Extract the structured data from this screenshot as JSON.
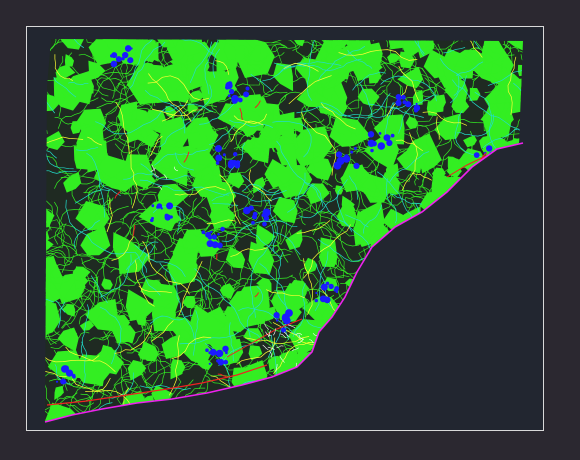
{
  "window": {
    "background": "#2b2830",
    "model_space_background": "#222630",
    "frame_color": "#d9d9d9"
  },
  "map": {
    "layers": [
      {
        "name": "land-green",
        "color": "#33ee22"
      },
      {
        "name": "roads-yellow",
        "color": "#ffff33"
      },
      {
        "name": "hydro-cyan",
        "color": "#22ddcc"
      },
      {
        "name": "water-blue",
        "color": "#1a1aff"
      },
      {
        "name": "rail-red",
        "color": "#ee2222"
      },
      {
        "name": "coast-magenta",
        "color": "#ee22ee"
      },
      {
        "name": "urban-white",
        "color": "#ffffff"
      }
    ]
  }
}
